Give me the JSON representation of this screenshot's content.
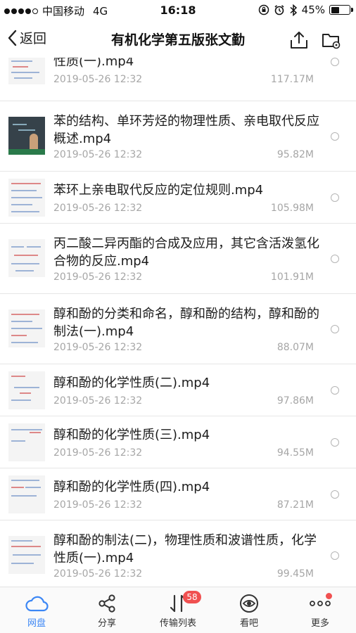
{
  "status_bar": {
    "carrier": "中国移动",
    "network": "4G",
    "time": "16:18",
    "battery_percent": "45%",
    "battery_level": 0.45,
    "signal_bars": 4
  },
  "nav": {
    "back_label": "返回",
    "title": "有机化学第五版张文勤"
  },
  "files": [
    {
      "name": "性质(一).mp4",
      "date": "2019-05-26 12:32",
      "size": "117.17M"
    },
    {
      "name": "苯的结构、单环芳烃的物理性质、亲电取代反应概述.mp4",
      "date": "2019-05-26 12:32",
      "size": "95.82M"
    },
    {
      "name": "苯环上亲电取代反应的定位规则.mp4",
      "date": "2019-05-26 12:32",
      "size": "105.98M"
    },
    {
      "name": "丙二酸二异丙酯的合成及应用，其它含活泼氢化合物的反应.mp4",
      "date": "2019-05-26 12:32",
      "size": "101.91M"
    },
    {
      "name": "醇和酚的分类和命名，醇和酚的结构，醇和酚的制法(一).mp4",
      "date": "2019-05-26 12:32",
      "size": "88.07M"
    },
    {
      "name": "醇和酚的化学性质(二).mp4",
      "date": "2019-05-26 12:32",
      "size": "97.86M"
    },
    {
      "name": "醇和酚的化学性质(三).mp4",
      "date": "2019-05-26 12:32",
      "size": "94.55M"
    },
    {
      "name": "醇和酚的化学性质(四).mp4",
      "date": "2019-05-26 12:32",
      "size": "87.21M"
    },
    {
      "name": "醇和酚的制法(二)，物理性质和波谱性质，化学性质(一).mp4",
      "date": "2019-05-26 12:32",
      "size": "99.45M"
    }
  ],
  "tabs": [
    {
      "label": "网盘",
      "icon": "cloud-icon"
    },
    {
      "label": "分享",
      "icon": "share-icon"
    },
    {
      "label": "传输列表",
      "icon": "transfer-icon",
      "badge": "58"
    },
    {
      "label": "看吧",
      "icon": "eye-icon"
    },
    {
      "label": "更多",
      "icon": "more-icon"
    }
  ],
  "colors": {
    "accent": "#3c87f5",
    "badge": "#f05050",
    "secondary_text": "#a6a6a6"
  }
}
